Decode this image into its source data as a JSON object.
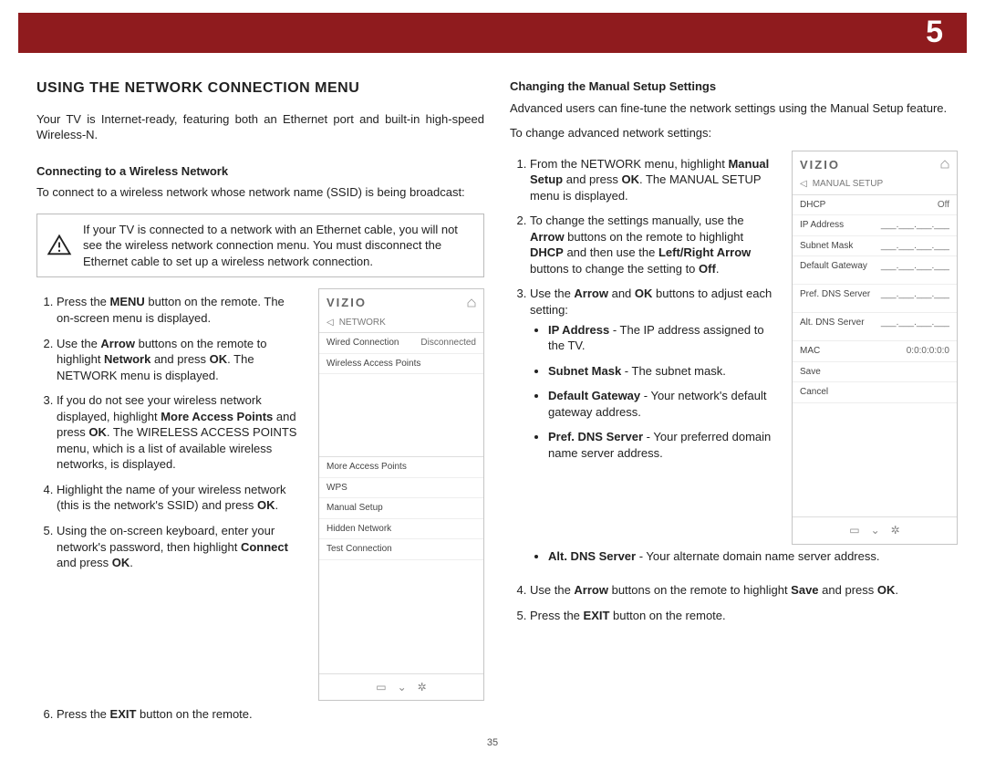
{
  "page": {
    "chapter_number": "5",
    "footer_page": "35"
  },
  "left": {
    "title": "USING THE NETWORK CONNECTION MENU",
    "intro": "Your TV is Internet-ready, featuring both an Ethernet port and built-in high-speed Wireless-N.",
    "sub1": "Connecting to a Wireless Network",
    "sub1_p": "To connect to a wireless network whose network name (SSID) is being broadcast:",
    "warning": "If your TV is connected to a network with an Ethernet cable, you will not see the wireless network connection menu. You must disconnect the Ethernet cable to set up a wireless network connection.",
    "steps": {
      "s1a": "Press the ",
      "s1b": "MENU",
      "s1c": " button on the remote. The on-screen menu is displayed.",
      "s2a": "Use the ",
      "s2b": "Arrow",
      "s2c": " buttons on the remote to highlight ",
      "s2d": "Network",
      "s2e": " and press ",
      "s2f": "OK",
      "s2g": ". The NETWORK menu is displayed.",
      "s3a": "If you do not see your wireless network displayed, highlight ",
      "s3b": "More Access Points",
      "s3c": " and press ",
      "s3d": "OK",
      "s3e": ". The WIRELESS ACCESS POINTS menu, which is a list of available wireless networks, is displayed.",
      "s4a": "Highlight the name of your wireless network (this is the network's SSID) and press ",
      "s4b": "OK",
      "s4c": ".",
      "s5a": "Using the on-screen keyboard, enter your network's password, then highlight ",
      "s5b": "Connect",
      "s5c": " and press ",
      "s5d": "OK",
      "s5e": ".",
      "s6a": "Press the ",
      "s6b": "EXIT",
      "s6c": " button on the remote."
    },
    "osd": {
      "brand": "VIZIO",
      "subtitle": "NETWORK",
      "rows": [
        {
          "label": "Wired Connection",
          "value": "Disconnected"
        },
        {
          "label": "Wireless Access Points",
          "value": ""
        }
      ],
      "rows2": [
        {
          "label": "More Access Points",
          "value": ""
        },
        {
          "label": "WPS",
          "value": ""
        },
        {
          "label": "Manual Setup",
          "value": ""
        },
        {
          "label": "Hidden Network",
          "value": ""
        },
        {
          "label": "Test Connection",
          "value": ""
        }
      ]
    }
  },
  "right": {
    "sub": "Changing the Manual Setup Settings",
    "intro": "Advanced users can fine-tune the network settings using the Manual Setup feature.",
    "lead": "To change advanced network settings:",
    "steps": {
      "s1a": "From the NETWORK menu, highlight ",
      "s1b": "Manual Setup",
      "s1c": " and press ",
      "s1d": "OK",
      "s1e": ". The MANUAL SETUP menu is displayed.",
      "s2a": "To change the settings manually, use the ",
      "s2b": "Arrow",
      "s2c": " buttons on the remote to highlight ",
      "s2d": "DHCP",
      "s2e": " and then use the ",
      "s2f": "Left/Right Arrow",
      "s2g": " buttons to change the setting to ",
      "s2h": "Off",
      "s2i": ".",
      "s3a": "Use the ",
      "s3b": "Arrow",
      "s3c": " and ",
      "s3d": "OK",
      "s3e": " buttons to adjust each setting:",
      "b_ip_t": "IP Address",
      "b_ip_r": " - The IP address assigned to the TV.",
      "b_sm_t": "Subnet Mask",
      "b_sm_r": " - The subnet mask.",
      "b_dg_t": "Default Gateway",
      "b_dg_r": " - Your network's default gateway address.",
      "b_pd_t": "Pref. DNS Server",
      "b_pd_r": " - Your preferred domain name server address.",
      "b_ad_t": "Alt. DNS Server",
      "b_ad_r": " - Your alternate domain name server address.",
      "s4a": "Use the ",
      "s4b": "Arrow",
      "s4c": " buttons on the remote to highlight ",
      "s4d": "Save",
      "s4e": " and press ",
      "s4f": "OK",
      "s4g": ".",
      "s5a": "Press the ",
      "s5b": "EXIT",
      "s5c": " button on the remote."
    },
    "osd": {
      "brand": "VIZIO",
      "subtitle": "MANUAL SETUP",
      "rows": [
        {
          "label": "DHCP",
          "value": "Off"
        },
        {
          "label": "IP Address",
          "value": "___.___.___.___"
        },
        {
          "label": "Subnet Mask",
          "value": "___.___.___.___"
        },
        {
          "label": "Default Gateway",
          "value": "___.___.___.___"
        },
        {
          "label": "Pref. DNS Server",
          "value": "___.___.___.___"
        },
        {
          "label": "Alt. DNS Server",
          "value": "___.___.___.___"
        },
        {
          "label": "MAC",
          "value": "0:0:0:0:0:0"
        },
        {
          "label": "Save",
          "value": ""
        },
        {
          "label": "Cancel",
          "value": ""
        }
      ]
    }
  }
}
